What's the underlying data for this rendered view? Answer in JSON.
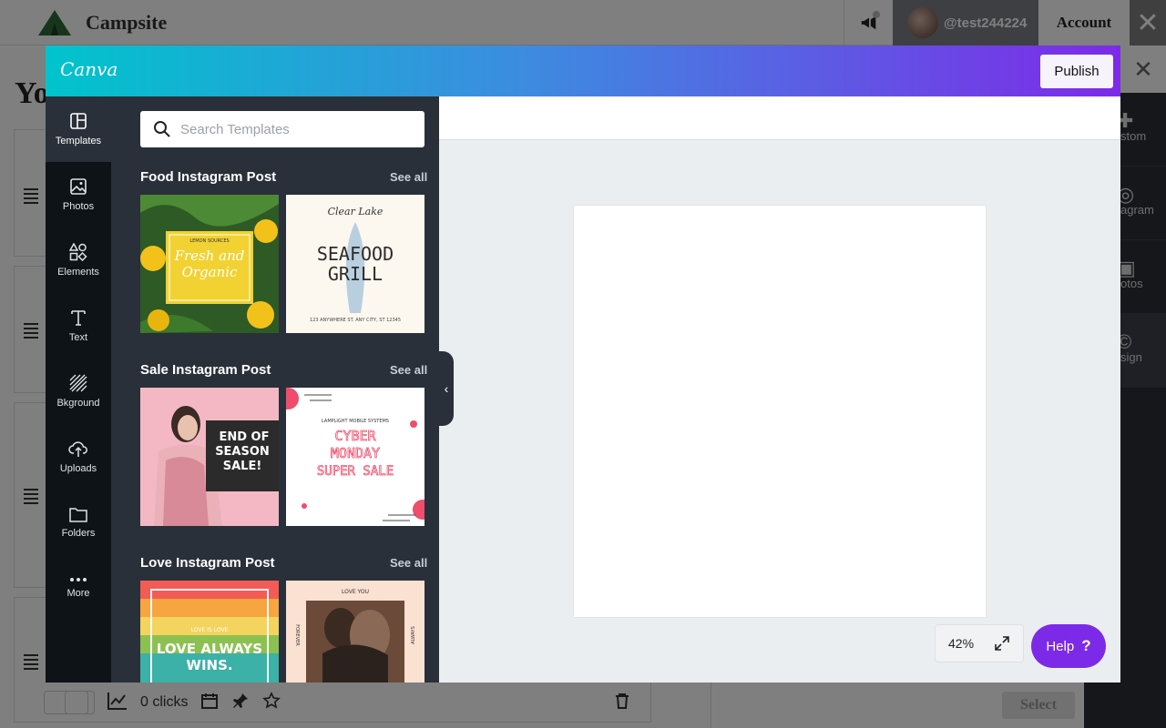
{
  "app": {
    "brand": "Campsite",
    "username": "@test244224",
    "account_label": "Account",
    "page_heading": "Yo"
  },
  "background_page": {
    "clicks_label": "0 clicks",
    "select_label": "Select",
    "right_panel_items": [
      "stom",
      "agram",
      "otos",
      "sign"
    ]
  },
  "canva": {
    "logo": "Canva",
    "publish_label": "Publish",
    "search_placeholder": "Search Templates",
    "rail": [
      {
        "label": "Templates",
        "icon": "templates-icon",
        "active": true
      },
      {
        "label": "Photos",
        "icon": "photos-icon",
        "active": false
      },
      {
        "label": "Elements",
        "icon": "elements-icon",
        "active": false
      },
      {
        "label": "Text",
        "icon": "text-icon",
        "active": false
      },
      {
        "label": "Bkground",
        "icon": "background-icon",
        "active": false
      },
      {
        "label": "Uploads",
        "icon": "uploads-icon",
        "active": false
      },
      {
        "label": "Folders",
        "icon": "folders-icon",
        "active": false
      },
      {
        "label": "More",
        "icon": "more-icon",
        "active": false
      }
    ],
    "sections": [
      {
        "title": "Food Instagram Post",
        "see_all": "See all",
        "templates": [
          {
            "lines": [
              "LEMON SOURCES",
              "Fresh and",
              "Organic"
            ]
          },
          {
            "lines": [
              "Clear Lake",
              "SEAFOOD",
              "GRILL",
              "123 ANYWHERE ST. ANY CITY, ST 12345"
            ]
          }
        ]
      },
      {
        "title": "Sale Instagram Post",
        "see_all": "See all",
        "templates": [
          {
            "lines": [
              "END OF",
              "SEASON",
              "SALE!"
            ]
          },
          {
            "lines": [
              "LAMPLIGHT MOBILE SYSTEMS",
              "CYBER",
              "MONDAY",
              "SUPER SALE"
            ]
          }
        ]
      },
      {
        "title": "Love Instagram Post",
        "see_all": "See all",
        "templates": [
          {
            "lines": [
              "LOVE IS LOVE",
              "LOVE ALWAYS",
              "WINS."
            ]
          },
          {
            "lines": [
              "LOVE YOU",
              "FOREVER",
              "ALWAYS"
            ]
          }
        ]
      }
    ],
    "zoom_label": "42%",
    "help_label": "Help",
    "help_glyph": "?"
  },
  "colors": {
    "canva_purple": "#7d2ae8",
    "canva_teal": "#00c4cc",
    "panel_dark": "#293039",
    "rail_dark": "#0e1318"
  }
}
